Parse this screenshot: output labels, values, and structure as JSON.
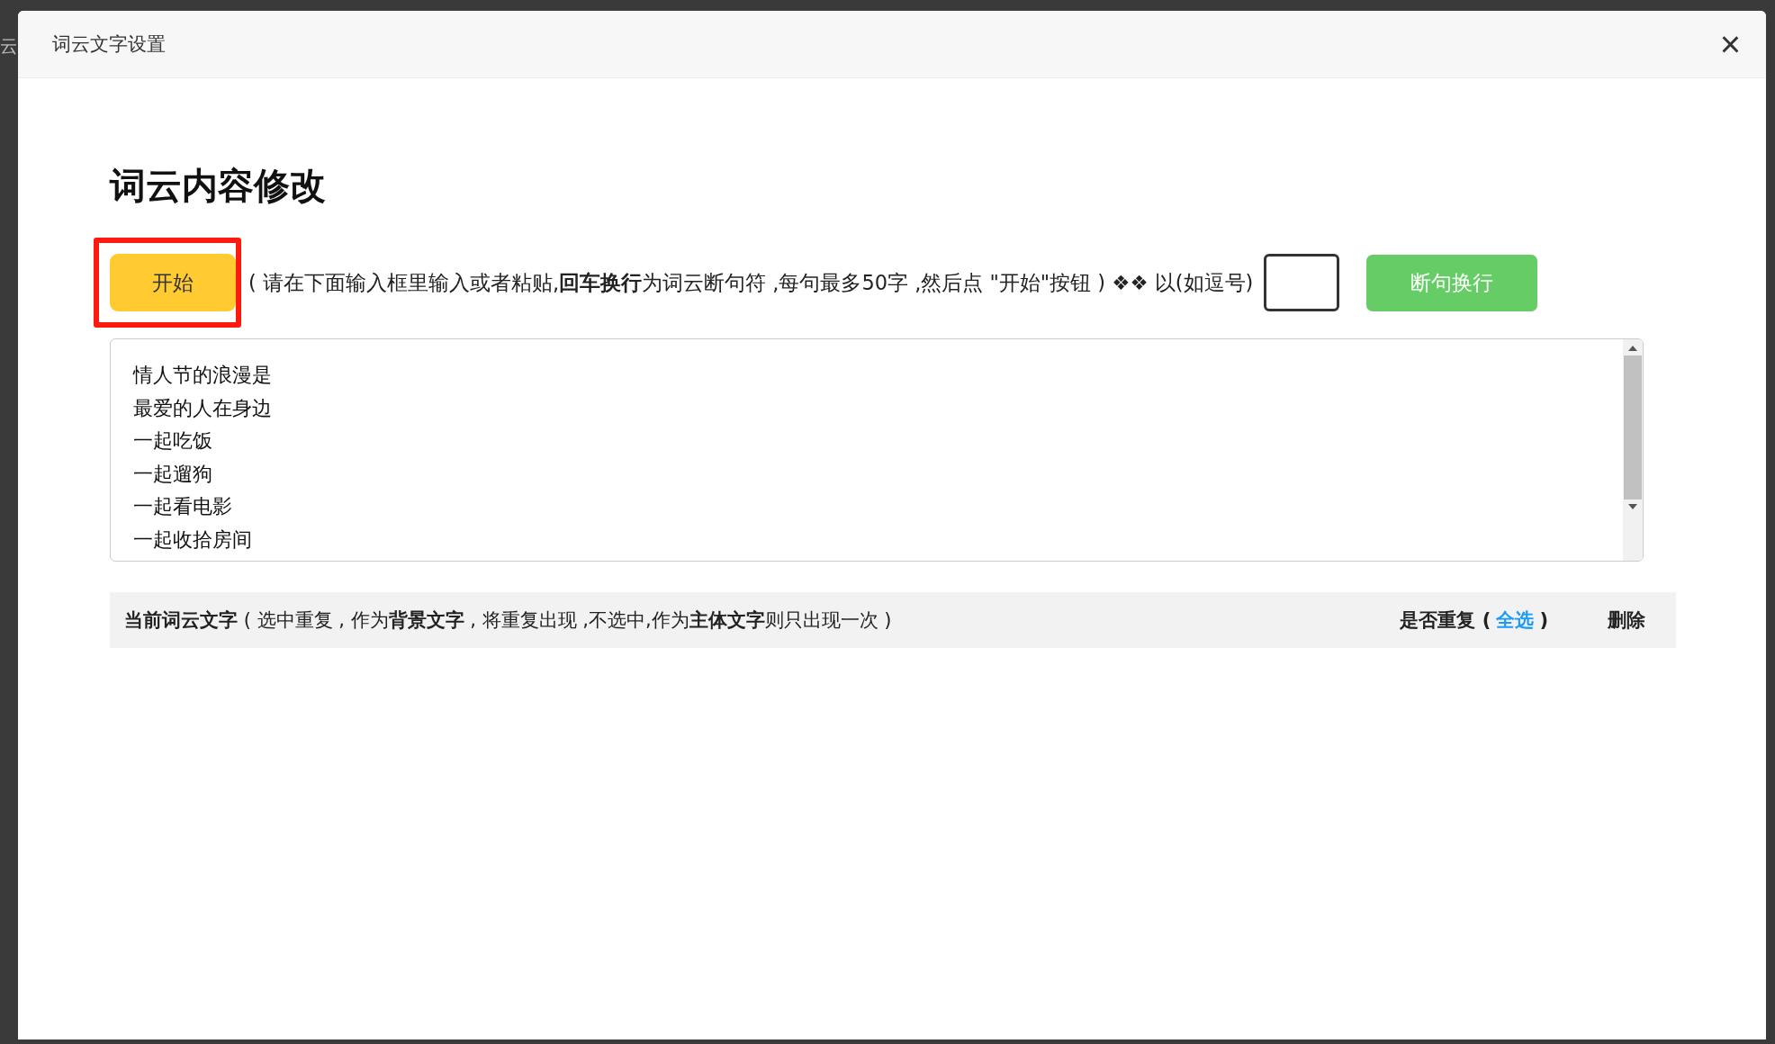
{
  "background_fragment": "云",
  "dialog": {
    "title": "词云文字设置",
    "close": "×"
  },
  "heading": "词云内容修改",
  "start_button": {
    "label": "开始",
    "highlighted": true
  },
  "instruction": "( 请在下面输入框里输入或者粘贴,**回车换行**为词云断句符 ,每句最多50字 ,然后点 \"开始\"按钮 ) ❖❖ 以(如逗号)",
  "split_button": {
    "label": "断句换行"
  },
  "text_lines": [
    "情人节的浪漫是",
    "最爱的人在身边",
    "一起吃饭",
    "一起遛狗",
    "一起看电影",
    "一起收拾房间"
  ],
  "current_words_bar": {
    "description": "**当前词云文字** ( 选中重复 , 作为**背景文字** , 将重复出现 ,不选中,作为**主体文字**则只出现一次 )",
    "repeat_label": "是否重复 (",
    "select_all": "全选",
    "repeat_close": ")",
    "delete_label": "删除"
  }
}
